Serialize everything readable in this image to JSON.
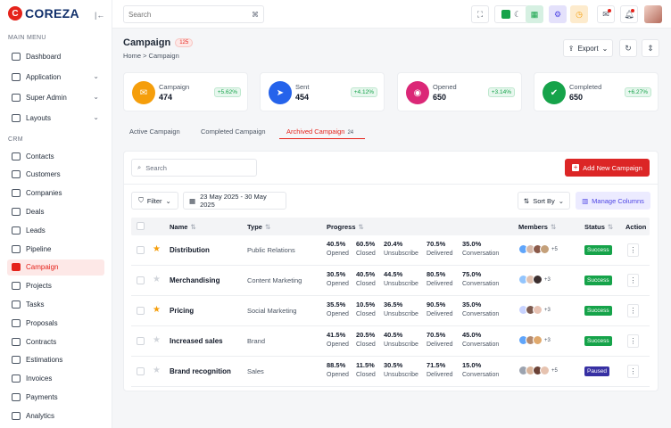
{
  "brand": {
    "name": "COREZA",
    "logo_letter": "C"
  },
  "sidebar": {
    "main_menu_label": "MAIN MENU",
    "crm_label": "CRM",
    "main_items": [
      {
        "label": "Dashboard",
        "icon": "dashboard-icon",
        "has_children": false
      },
      {
        "label": "Application",
        "icon": "application-icon",
        "has_children": true
      },
      {
        "label": "Super Admin",
        "icon": "user-shield-icon",
        "has_children": true
      },
      {
        "label": "Layouts",
        "icon": "layout-icon",
        "has_children": true
      }
    ],
    "crm_items": [
      {
        "label": "Contacts",
        "icon": "contact-icon"
      },
      {
        "label": "Customers",
        "icon": "customers-icon"
      },
      {
        "label": "Companies",
        "icon": "building-icon"
      },
      {
        "label": "Deals",
        "icon": "deals-icon"
      },
      {
        "label": "Leads",
        "icon": "leads-icon"
      },
      {
        "label": "Pipeline",
        "icon": "pipeline-icon"
      },
      {
        "label": "Campaign",
        "icon": "campaign-icon",
        "active": true
      },
      {
        "label": "Projects",
        "icon": "projects-icon"
      },
      {
        "label": "Tasks",
        "icon": "tasks-icon"
      },
      {
        "label": "Proposals",
        "icon": "proposals-icon"
      },
      {
        "label": "Contracts",
        "icon": "contracts-icon"
      },
      {
        "label": "Estimations",
        "icon": "estimations-icon"
      },
      {
        "label": "Invoices",
        "icon": "invoices-icon"
      },
      {
        "label": "Payments",
        "icon": "payments-icon"
      },
      {
        "label": "Analytics",
        "icon": "analytics-icon"
      }
    ]
  },
  "topbar": {
    "search_placeholder": "Search",
    "shortcut": "⌘"
  },
  "header": {
    "title": "Campaign",
    "count": "125",
    "breadcrumb": "Home  >  Campaign",
    "export_label": "Export"
  },
  "stats": [
    {
      "label": "Campaign",
      "value": "474",
      "delta": "+5.62%",
      "color": "#f59e0b",
      "icon": "campaign-stat-icon"
    },
    {
      "label": "Sent",
      "value": "454",
      "delta": "+4.12%",
      "color": "#2563eb",
      "icon": "send-icon"
    },
    {
      "label": "Opened",
      "value": "650",
      "delta": "+3.14%",
      "color": "#db2777",
      "icon": "opened-icon"
    },
    {
      "label": "Completed",
      "value": "650",
      "delta": "+6.27%",
      "color": "#16a34a",
      "icon": "check-double-icon"
    }
  ],
  "tabs": [
    {
      "label": "Active Campaign"
    },
    {
      "label": "Completed Campaign"
    },
    {
      "label": "Archived Campaign",
      "count": "24",
      "active": true
    }
  ],
  "toolbar": {
    "search_placeholder": "Search",
    "add_label": "Add New Campaign",
    "filter_label": "Filter",
    "date_range": "23 May 2025 - 30 May 2025",
    "sort_label": "Sort By",
    "manage_label": "Manage Columns"
  },
  "table": {
    "headers": {
      "name": "Name",
      "type": "Type",
      "progress": "Progress",
      "members": "Members",
      "status": "Status",
      "action": "Action"
    },
    "metric_labels": [
      "Opened",
      "Closed",
      "Unsubscribe",
      "Delivered",
      "Conversation"
    ],
    "rows": [
      {
        "starred": true,
        "name": "Distribution",
        "type": "Public Relations",
        "metrics": [
          "40.5%",
          "60.5%",
          "20.4%",
          "70.5%",
          "35.0%"
        ],
        "more_members": "+5",
        "status": "Success"
      },
      {
        "starred": false,
        "name": "Merchandising",
        "type": "Content Marketing",
        "metrics": [
          "30.5%",
          "40.5%",
          "44.5%",
          "80.5%",
          "75.0%"
        ],
        "more_members": "+3",
        "status": "Success"
      },
      {
        "starred": true,
        "name": "Pricing",
        "type": "Social Marketing",
        "metrics": [
          "35.5%",
          "10.5%",
          "36.5%",
          "90.5%",
          "35.0%"
        ],
        "more_members": "+3",
        "status": "Success"
      },
      {
        "starred": false,
        "name": "Increased sales",
        "type": "Brand",
        "metrics": [
          "41.5%",
          "20.5%",
          "40.5%",
          "70.5%",
          "45.0%"
        ],
        "more_members": "+3",
        "status": "Success"
      },
      {
        "starred": false,
        "name": "Brand recognition",
        "type": "Sales",
        "metrics": [
          "88.5%",
          "11.5%",
          "30.5%",
          "71.5%",
          "15.0%"
        ],
        "more_members": "+5",
        "status": "Paused"
      }
    ]
  },
  "colors": {
    "accent": "#e5231b",
    "success": "#16a34a",
    "paused": "#3730a3",
    "manage": "#4f46e5"
  }
}
